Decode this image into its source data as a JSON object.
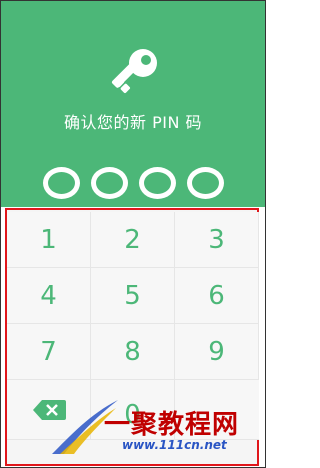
{
  "header": {
    "icon": "key-icon",
    "title": "确认您的新 PIN 码",
    "pin_length": 4,
    "accent_color": "#4cb778"
  },
  "keypad": {
    "keys": [
      "1",
      "2",
      "3",
      "4",
      "5",
      "6",
      "7",
      "8",
      "9",
      "0"
    ],
    "delete_icon": "backspace-icon",
    "highlight_border_color": "#e0161b"
  },
  "watermark": {
    "text": "一聚教程网",
    "url": "www.111cn.net"
  }
}
